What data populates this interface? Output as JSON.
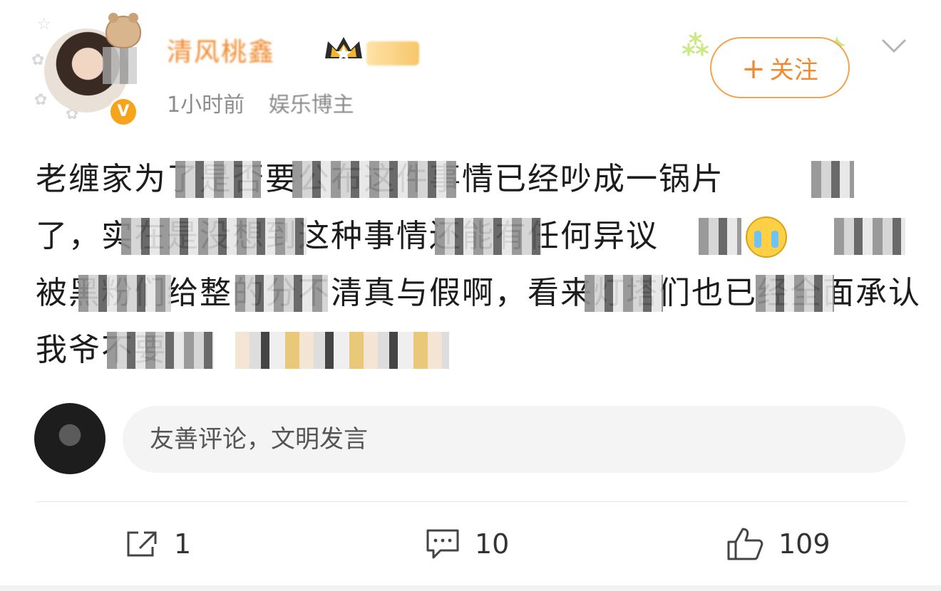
{
  "author": {
    "name": "清风桃鑫",
    "time": "1小时前",
    "source": "娱乐博主"
  },
  "follow_button": {
    "plus": "+",
    "label": "关注"
  },
  "post": {
    "lines": [
      "老缠家为了是否要公布这件事情已经吵成一锅片",
      "了，实在是没想到这种事情还能有任何异议",
      "被黑粉们给整的分不清真与假啊，看来灯塔们也已经全面承认",
      "我爷不要"
    ]
  },
  "comment_box": {
    "placeholder": "友善评论，文明发言"
  },
  "actions": {
    "repost_count": "1",
    "comment_count": "10",
    "like_count": "109"
  },
  "colors": {
    "accent": "#f08a2c",
    "follow_border": "#f7a14a",
    "meta_text": "#8c8c8c",
    "body_text": "#1c1c1c",
    "input_bg": "#f4f4f4"
  },
  "icons": {
    "verified": "verified-v-icon",
    "crown": "crown-icon",
    "chevron": "chevron-down-icon",
    "repost": "repost-icon",
    "comment": "comment-icon",
    "like": "thumbs-up-icon",
    "sob_emoji": "crying-emoji-icon"
  }
}
